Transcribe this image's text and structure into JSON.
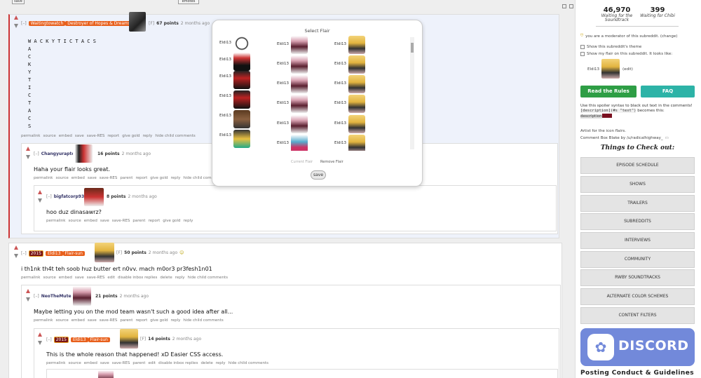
{
  "top_buttons": {
    "left": "save",
    "right": "emotes"
  },
  "comments": [
    {
      "author": "Waitingtowatch",
      "flair": "Destroyer of Hopes & Dreams",
      "tag": "[F]",
      "points": "67 points",
      "time": "2 months ago",
      "collapse": "[–]",
      "text_rows": [
        "W A C K Y T I C T A C S",
        "A",
        "C",
        "K",
        "Y",
        "T",
        "I",
        "C",
        "T",
        "A",
        "C",
        "S"
      ],
      "actions": [
        "permalink",
        "source",
        "embed",
        "save",
        "save-RES",
        "report",
        "give gold",
        "reply",
        "hide child comments"
      ]
    },
    {
      "author": "Changyuraptor",
      "points": "16 points",
      "time": "2 months ago",
      "collapse": "[–]",
      "text": "Haha your flair looks great.",
      "actions": [
        "permalink",
        "source",
        "embed",
        "save",
        "save-RES",
        "parent",
        "report",
        "give gold",
        "reply",
        "hide child comments"
      ]
    },
    {
      "author": "bigfatcorp93",
      "points": "8 points",
      "time": "2 months ago",
      "collapse": "[–]",
      "text": "hoo duz dinasawrz?",
      "actions": [
        "permalink",
        "source",
        "embed",
        "save",
        "save-RES",
        "parent",
        "report",
        "give gold",
        "reply"
      ]
    },
    {
      "badge": "2015",
      "author": "Eldi13",
      "flair": "Flair-sun",
      "tag": "[F]",
      "points": "50 points",
      "time": "2 months ago",
      "collapse": "[–]",
      "text": "i th1nk th4t teh soob huz butter ert n0vv. mach m0or3 pr3fesh1n01",
      "actions": [
        "permalink",
        "source",
        "embed",
        "save",
        "save-RES",
        "edit",
        "disable inbox replies",
        "delete",
        "reply",
        "hide child comments"
      ]
    },
    {
      "author": "NeoTheMute",
      "points": "21 points",
      "time": "2 months ago",
      "collapse": "[–]",
      "text": "Maybe letting you on the mod team wasn't such a good idea after all...",
      "actions": [
        "permalink",
        "source",
        "embed",
        "save",
        "save-RES",
        "parent",
        "report",
        "give gold",
        "reply",
        "hide child comments"
      ]
    },
    {
      "badge": "2015",
      "author": "Eldi13",
      "flair": "Flair-sun",
      "tag": "[F]",
      "points": "14 points",
      "time": "2 months ago",
      "collapse": "[–]",
      "text": "This is the whole reason that happened! xD Easier CSS access.",
      "actions": [
        "permalink",
        "source",
        "embed",
        "save",
        "save-RES",
        "parent",
        "edit",
        "disable inbox replies",
        "delete",
        "reply",
        "hide child comments"
      ]
    }
  ],
  "modal": {
    "title": "Select Flair",
    "label": "Eldi13",
    "current": "Current Flair",
    "remove": "Remove Flair",
    "save": "save"
  },
  "sidebar": {
    "stats": [
      {
        "num": "46,970",
        "label": "Waiting for the Soundtrack"
      },
      {
        "num": "399",
        "label": "Waiting for Chibi"
      }
    ],
    "moderator": "you are a moderator of this subreddit. (change)",
    "show_theme": "Show this subreddit's theme",
    "show_flair": "Show my flair on this subreddit. It looks like:",
    "user": "Eldi13",
    "edit": "(edit)",
    "rules_btn": "Read the Rules",
    "faq_btn": "FAQ",
    "spoiler_text": "Use this spoiler syntax to black out text in the comments!",
    "spoiler_code": "[description](#s \"text\")",
    "spoiler_becomes": "becomes this:",
    "spoiler_demo": "description",
    "artist": "Artist for the icon flairs.",
    "comment_box": "Comment Box Blake by /u/radicalhighway_",
    "things_title": "Things to Check out:",
    "nav": [
      "EPISODE SCHEDULE",
      "SHOWS",
      "TRAILERS",
      "SUBREDDITS",
      "INTERVIEWS",
      "COMMUNITY",
      "RWBY SOUNDTRACKS",
      "ALTERNATE COLOR SCHEMES",
      "CONTENT FILTERS"
    ],
    "discord": "DISCORD",
    "posting": "Posting Conduct & Guidelines"
  },
  "colors": {
    "accent_orange": "#e8601c",
    "green": "#2e9e45",
    "teal": "#2db3a7",
    "discord": "#7289da"
  }
}
